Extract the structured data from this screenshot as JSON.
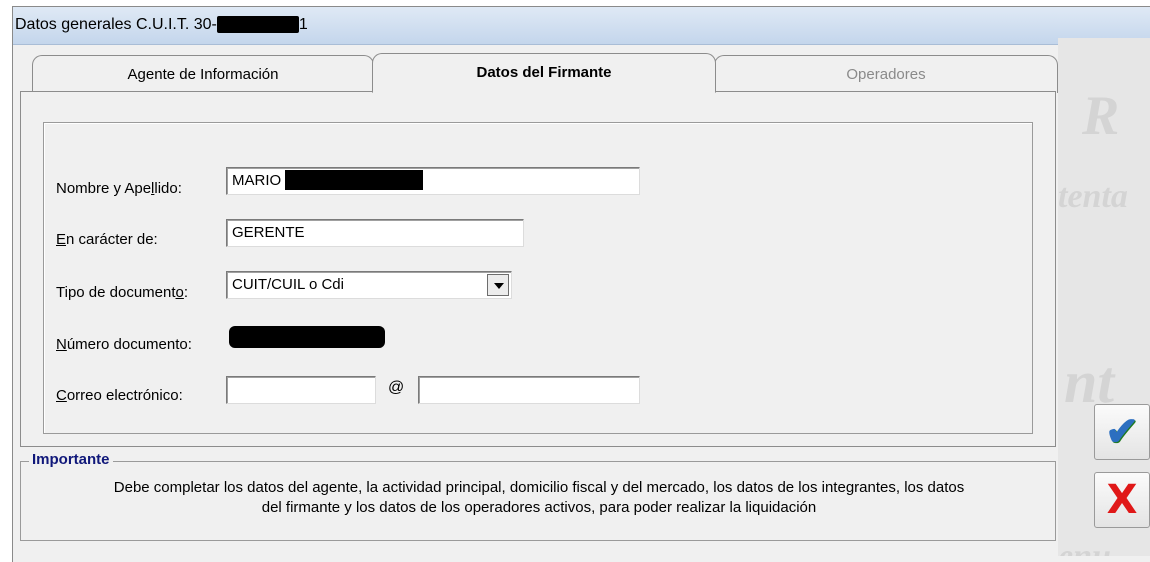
{
  "window": {
    "title_prefix": "Datos generales C.U.I.T. 30-",
    "title_suffix": "1"
  },
  "tabs": [
    {
      "label": "Agente de Información",
      "state": "normal"
    },
    {
      "label": "Datos del Firmante",
      "state": "active"
    },
    {
      "label": "Operadores",
      "state": "disabled"
    }
  ],
  "form": {
    "nombre_label_pre": "Nombre y Ape",
    "nombre_label_u": "l",
    "nombre_label_post": "lido:",
    "nombre_value": "MARIO",
    "caracter_label_u": "E",
    "caracter_label_post": "n carácter de:",
    "caracter_value": "GERENTE",
    "tipo_label_pre": "Tipo de document",
    "tipo_label_u": "o",
    "tipo_label_post": ":",
    "tipo_value": "CUIT/CUIL o Cdi",
    "numero_label_u": "N",
    "numero_label_post": "úmero documento:",
    "correo_label_u": "C",
    "correo_label_post": "orreo electrónico:",
    "correo_user_value": "",
    "at_sign": "@",
    "correo_domain_value": ""
  },
  "important": {
    "legend": "Importante",
    "line1": "Debe completar los datos del agente, la actividad principal, domicilio fiscal y del mercado, los datos de los integrantes, los datos",
    "line2": "del firmante y los datos de los operadores activos, para poder realizar la liquidación"
  },
  "side": {
    "accept_icon": "checkmark-icon",
    "cancel_icon": "x-icon",
    "accept_glyph": "✔",
    "cancel_glyph": "X"
  }
}
